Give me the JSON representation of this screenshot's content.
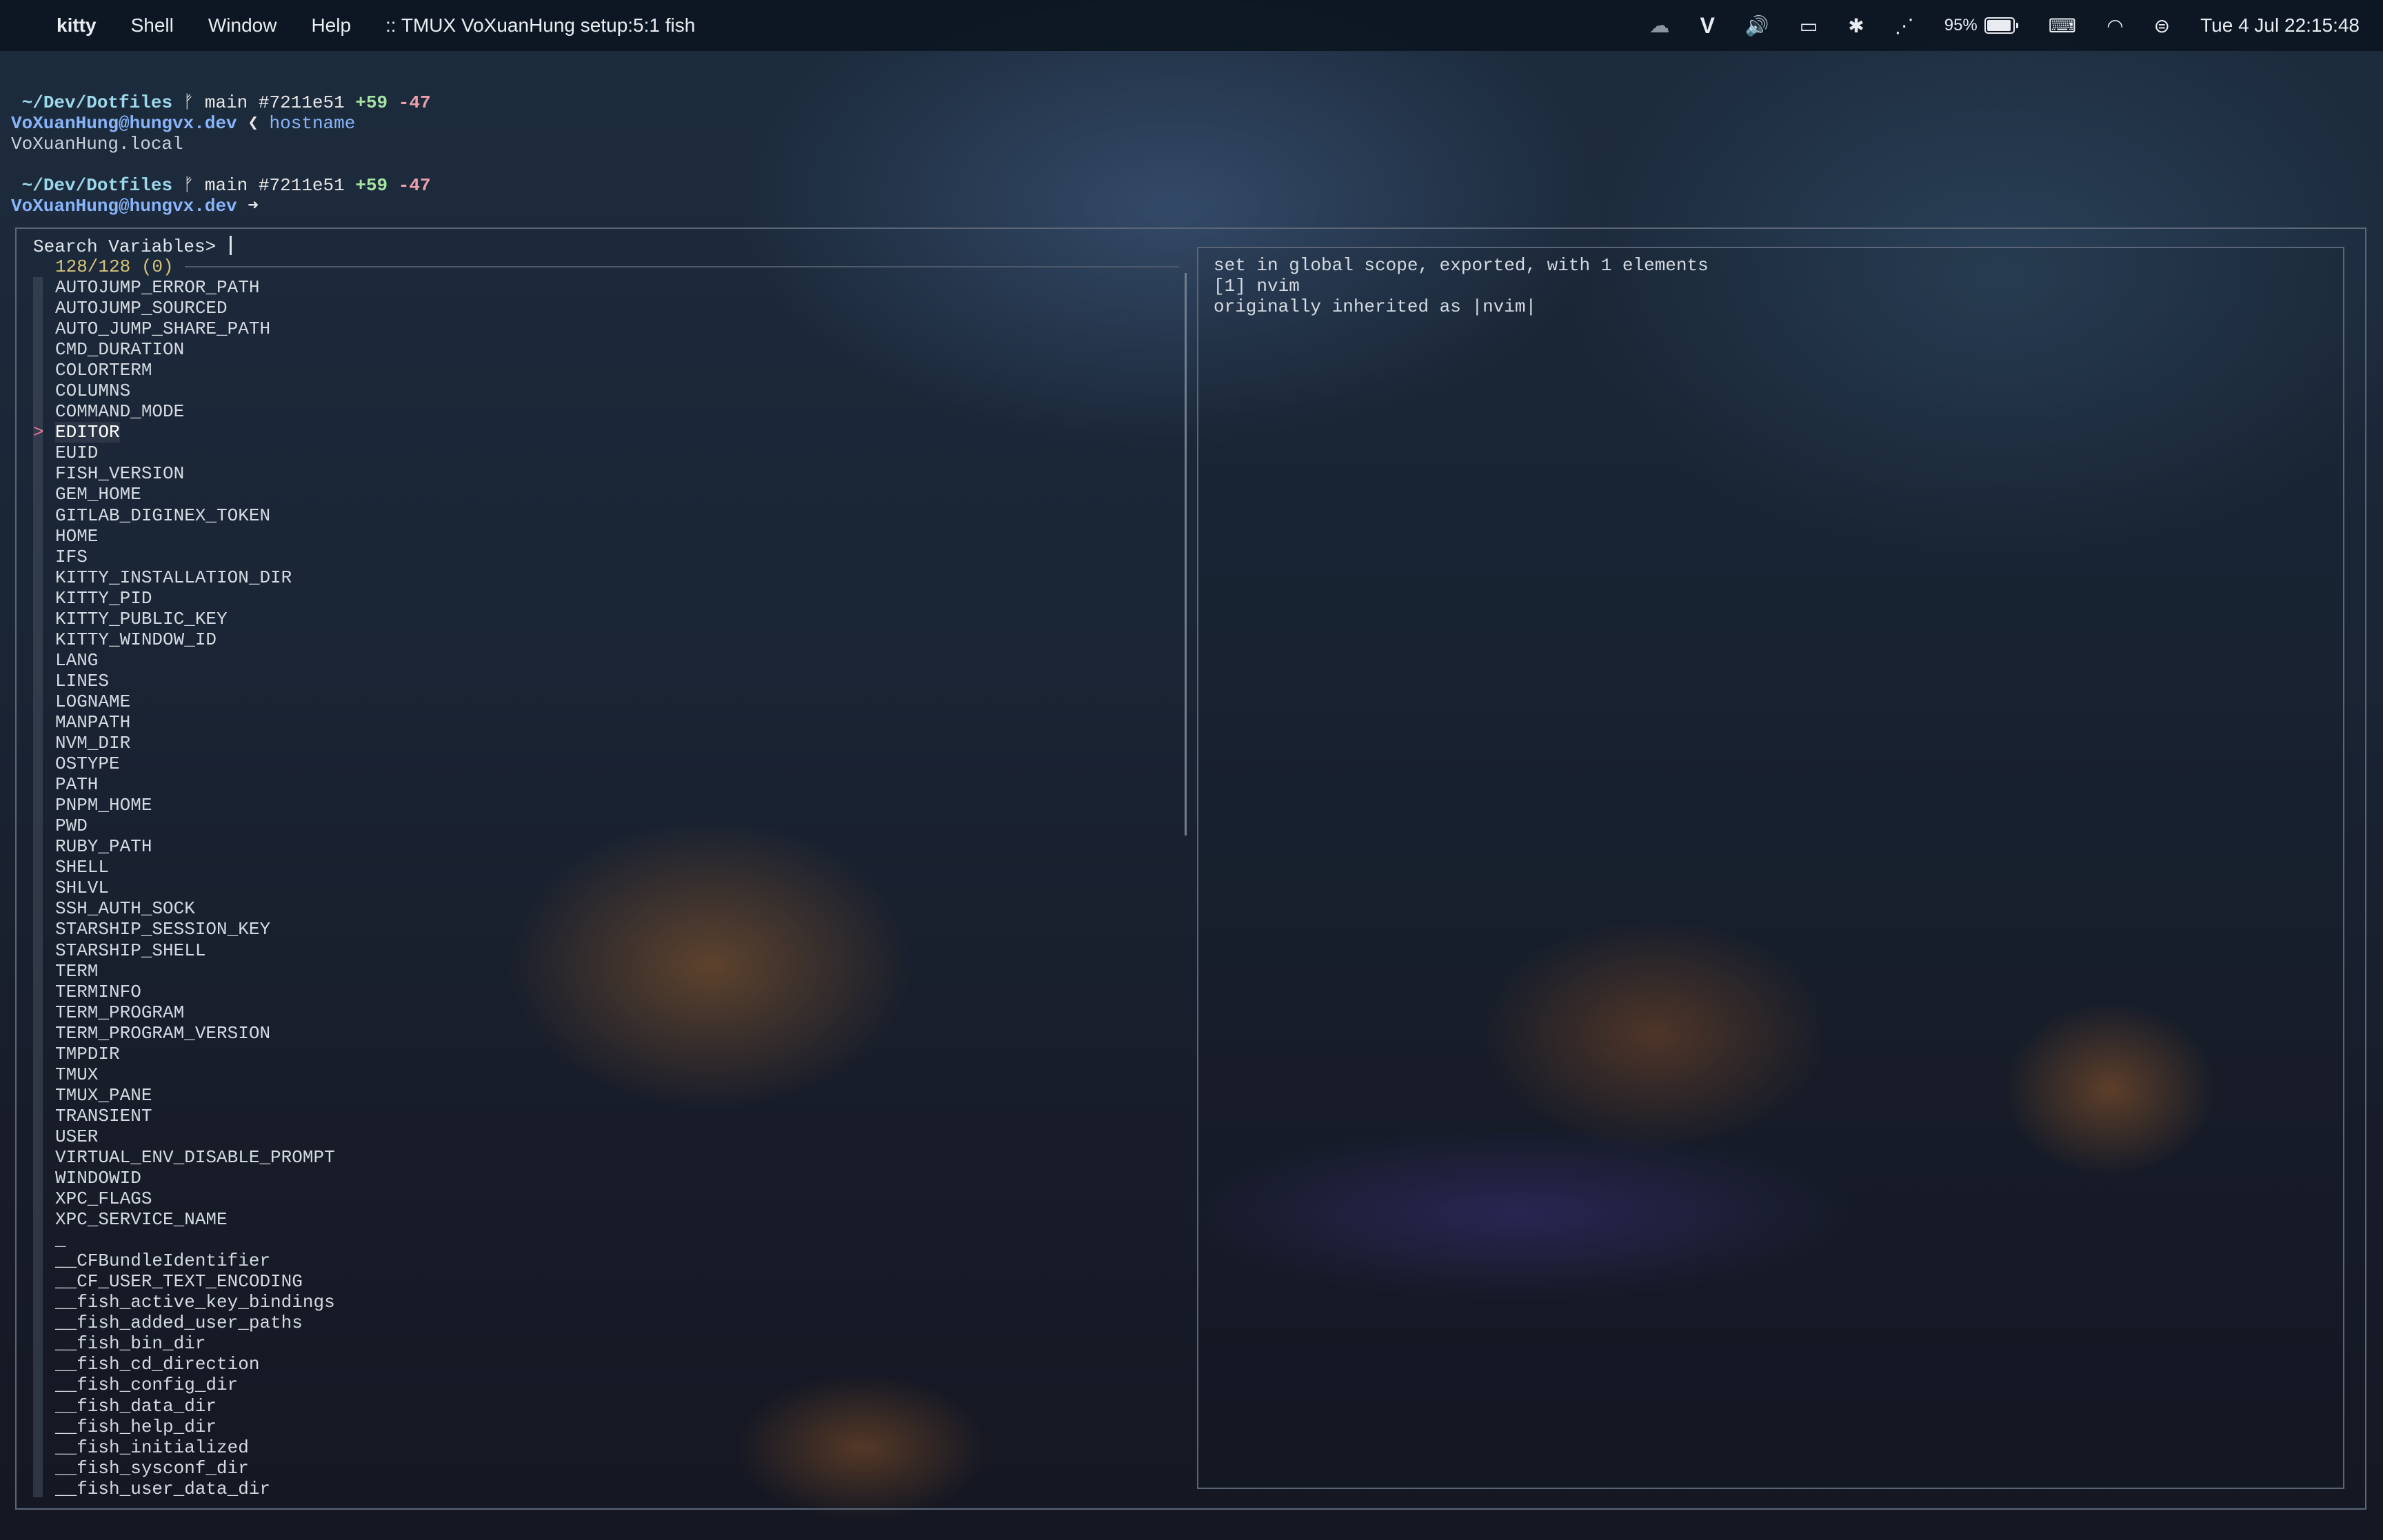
{
  "menubar": {
    "apple_glyph": "",
    "app_name": "kitty",
    "menus": [
      "Shell",
      "Window",
      "Help"
    ],
    "window_title": ":: TMUX VoXuanHung setup:5:1 fish",
    "status": {
      "cloud_glyph": "☁",
      "v_glyph": "V",
      "volume_glyph": "🔊",
      "display_glyph": "▭",
      "bluetooth_glyph": "✱",
      "dots_glyph": "⋰",
      "battery_percent": "95%",
      "battery_level": 0.95,
      "keyboard_glyph": "⌨",
      "wifi_glyph": "◠",
      "control_glyph": "⊜",
      "datetime": "Tue 4 Jul  22:15:48"
    }
  },
  "terminal": {
    "prompt1": {
      "apple": "",
      "path": "~/Dev/Dotfiles",
      "branch_glyph": "ᚠ",
      "branch": "main",
      "hash": "#7211e51",
      "added": "+59",
      "removed": "-47",
      "user": "VoXuanHung@hungvx.dev",
      "sep": "❮",
      "command": "hostname"
    },
    "output": "VoXuanHung.local",
    "prompt2": {
      "apple": "",
      "path": "~/Dev/Dotfiles",
      "branch_glyph": "ᚠ",
      "branch": "main",
      "hash": "#7211e51",
      "added": "+59",
      "removed": "-47",
      "user": "VoXuanHung@hungvx.dev",
      "arrow": "➜"
    }
  },
  "fzf": {
    "prompt": "Search Variables> ",
    "counter": "128/128 (0)",
    "pointer": ">",
    "items": [
      "AUTOJUMP_ERROR_PATH",
      "AUTOJUMP_SOURCED",
      "AUTO_JUMP_SHARE_PATH",
      "CMD_DURATION",
      "COLORTERM",
      "COLUMNS",
      "COMMAND_MODE",
      "EDITOR",
      "EUID",
      "FISH_VERSION",
      "GEM_HOME",
      "GITLAB_DIGINEX_TOKEN",
      "HOME",
      "IFS",
      "KITTY_INSTALLATION_DIR",
      "KITTY_PID",
      "KITTY_PUBLIC_KEY",
      "KITTY_WINDOW_ID",
      "LANG",
      "LINES",
      "LOGNAME",
      "MANPATH",
      "NVM_DIR",
      "OSTYPE",
      "PATH",
      "PNPM_HOME",
      "PWD",
      "RUBY_PATH",
      "SHELL",
      "SHLVL",
      "SSH_AUTH_SOCK",
      "STARSHIP_SESSION_KEY",
      "STARSHIP_SHELL",
      "TERM",
      "TERMINFO",
      "TERM_PROGRAM",
      "TERM_PROGRAM_VERSION",
      "TMPDIR",
      "TMUX",
      "TMUX_PANE",
      "TRANSIENT",
      "USER",
      "VIRTUAL_ENV_DISABLE_PROMPT",
      "WINDOWID",
      "XPC_FLAGS",
      "XPC_SERVICE_NAME",
      "_",
      "__CFBundleIdentifier",
      "__CF_USER_TEXT_ENCODING",
      "__fish_active_key_bindings",
      "__fish_added_user_paths",
      "__fish_bin_dir",
      "__fish_cd_direction",
      "__fish_config_dir",
      "__fish_data_dir",
      "__fish_help_dir",
      "__fish_initialized",
      "__fish_sysconf_dir",
      "__fish_user_data_dir"
    ],
    "selected_index": 7,
    "preview": [
      "set in global scope, exported, with 1 elements",
      "[1] nvim",
      "originally inherited as |nvim|"
    ]
  }
}
